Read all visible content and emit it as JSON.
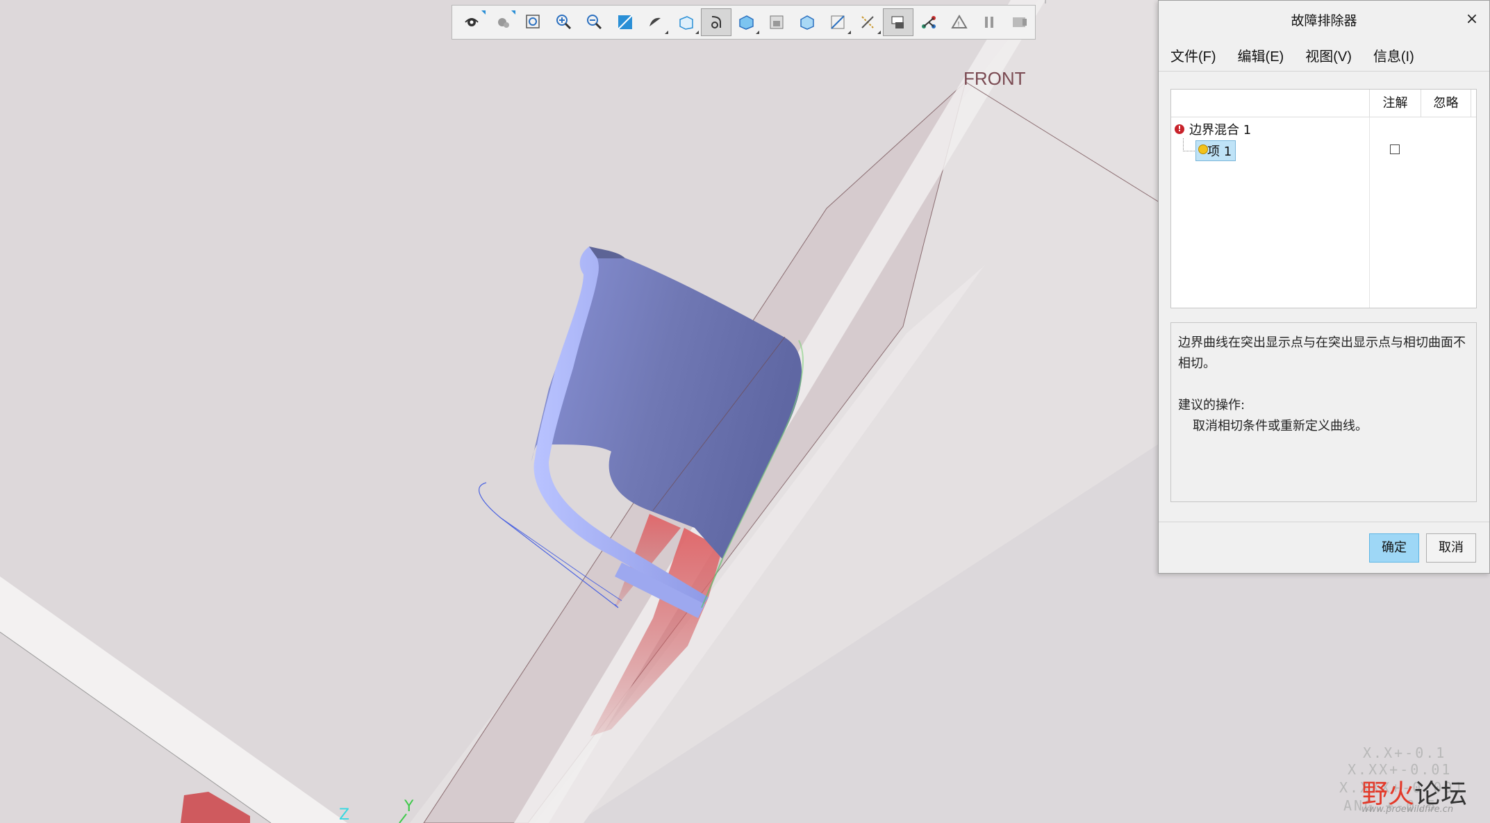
{
  "viewport": {
    "plane_label": "FRONT",
    "axis_z": "Z",
    "axis_y": "Y",
    "colors": {
      "background": "#ddd8da",
      "plane_fill": "#e7e3e4",
      "strip_fill": "#d4cacc",
      "surface_blue": "#7b84c4",
      "surface_light": "#a9b4f2",
      "surface_red": "#d6565a"
    }
  },
  "toolbar": {
    "icons": [
      {
        "name": "saved-view-orient-icon",
        "active": false
      },
      {
        "name": "appearance-icon",
        "active": false
      },
      {
        "name": "refit-icon",
        "active": false
      },
      {
        "name": "zoom-in-icon",
        "active": false
      },
      {
        "name": "zoom-out-icon",
        "active": false
      },
      {
        "name": "repaint-icon",
        "active": false
      },
      {
        "name": "display-style-icon",
        "active": false
      },
      {
        "name": "saved-orientations-icon",
        "active": false
      },
      {
        "name": "view-manager-icon",
        "active": true
      },
      {
        "name": "perspective-icon",
        "active": false
      },
      {
        "name": "section-icon",
        "active": false
      },
      {
        "name": "spin-center-icon",
        "active": false
      },
      {
        "name": "plane-display-icon",
        "active": false
      },
      {
        "name": "datum-display-icon",
        "active": false
      },
      {
        "name": "annotation-display-icon",
        "active": true
      },
      {
        "name": "tangent-chain-icon",
        "active": false
      },
      {
        "name": "csys-display-icon",
        "active": false
      },
      {
        "name": "pause-icon",
        "active": false
      },
      {
        "name": "resume-icon",
        "active": false
      }
    ]
  },
  "dialog": {
    "title": "故障排除器",
    "close": "×",
    "menu": [
      "文件(F)",
      "编辑(E)",
      "视图(V)",
      "信息(I)"
    ],
    "tree": {
      "columns": [
        "注解",
        "忽略"
      ],
      "root_label": "边界混合 1",
      "child_label": "项 1",
      "child_note_checked": false
    },
    "message": {
      "description": "边界曲线在突出显示点与在突出显示点与相切曲面不相切。",
      "suggestion_title": "建议的操作:",
      "suggestion_action": "取消相切条件或重新定义曲线。"
    },
    "buttons": {
      "ok": "确定",
      "cancel": "取消"
    }
  },
  "watermark": {
    "ticks": [
      "X.X+-0.1",
      "X.XX+-0.01",
      "X.XXX+-0.001",
      "ANG.+-0.5"
    ],
    "logo_a": "野火",
    "logo_b": "论坛",
    "url": "www.proewildfire.cn"
  }
}
